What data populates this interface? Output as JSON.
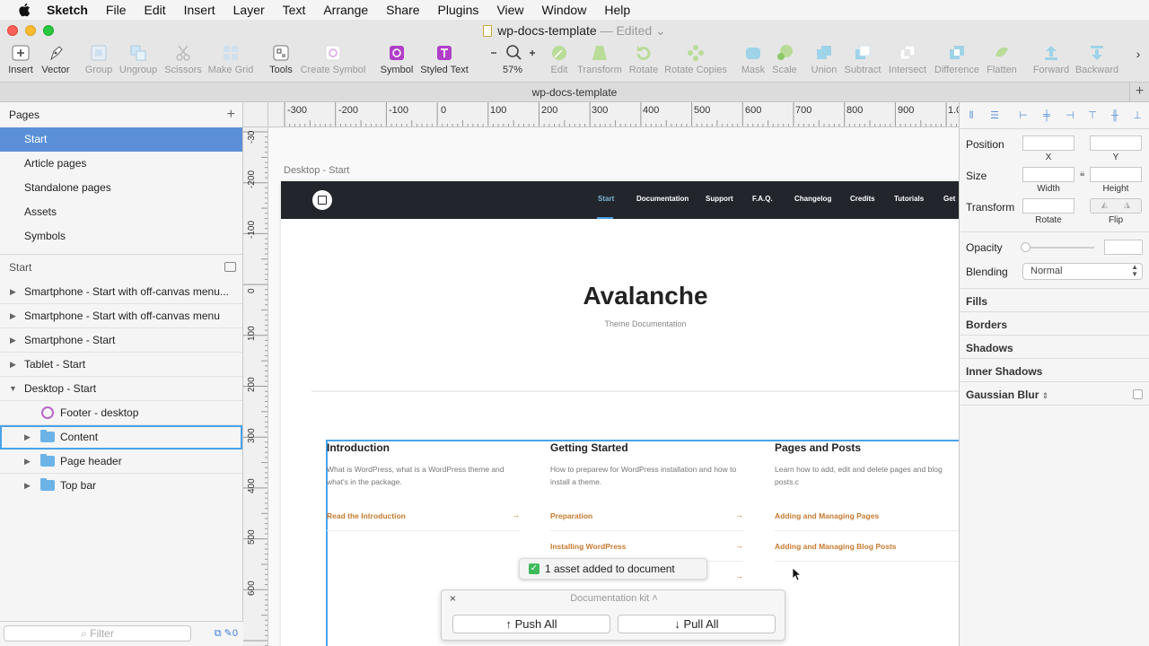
{
  "menubar": {
    "items": [
      "Sketch",
      "File",
      "Edit",
      "Insert",
      "Layer",
      "Text",
      "Arrange",
      "Share",
      "Plugins",
      "View",
      "Window",
      "Help"
    ]
  },
  "window": {
    "title": "wp-docs-template",
    "status": "— Edited"
  },
  "toolbar": {
    "insert": "Insert",
    "vector": "Vector",
    "group": "Group",
    "ungroup": "Ungroup",
    "scissors": "Scissors",
    "make_grid": "Make Grid",
    "tools": "Tools",
    "create_symbol": "Create Symbol",
    "symbol": "Symbol",
    "styled_text": "Styled Text",
    "zoom": "57%",
    "edit": "Edit",
    "transform": "Transform",
    "rotate": "Rotate",
    "rotate_copies": "Rotate Copies",
    "mask": "Mask",
    "scale": "Scale",
    "union": "Union",
    "subtract": "Subtract",
    "intersect": "Intersect",
    "difference": "Difference",
    "flatten": "Flatten",
    "forward": "Forward",
    "backward": "Backward",
    "colors": {
      "accent_purple": "#b040c8",
      "accent_green": "#7bc043",
      "accent_blue": "#5aa8d8"
    }
  },
  "tabbar": {
    "doc": "wp-docs-template"
  },
  "pages": {
    "header": "Pages",
    "items": [
      "Start",
      "Article pages",
      "Standalone pages",
      "Assets",
      "Symbols"
    ],
    "selected": "Start"
  },
  "layers": {
    "header": "Start",
    "items": [
      "Smartphone - Start with off-canvas menu...",
      "Smartphone - Start with off-canvas menu",
      "Smartphone - Start",
      "Tablet - Start",
      "Desktop - Start",
      "Footer - desktop",
      "Content",
      "Page header",
      "Top bar"
    ],
    "filter_placeholder": "Filter",
    "count": "0"
  },
  "ruler": {
    "top": [
      "-300",
      "-200",
      "-100",
      "0",
      "100",
      "200",
      "300",
      "400",
      "500",
      "600",
      "700",
      "800",
      "900",
      "1.0"
    ],
    "left": [
      "-30",
      "-200",
      "-100",
      "0",
      "100",
      "200",
      "300",
      "400",
      "500",
      "600"
    ]
  },
  "artboard": {
    "label": "Desktop - Start",
    "nav": [
      "Start",
      "Documentation",
      "Support",
      "F.A.Q.",
      "Changelog",
      "Credits",
      "Tutorials",
      "Get"
    ],
    "hero_title": "Avalanche",
    "hero_sub": "Theme Documentation",
    "columns": [
      {
        "title": "Introduction",
        "desc": "What is WordPress, what is a WordPress theme and what's in the package.",
        "links": [
          "Read the Introduction"
        ]
      },
      {
        "title": "Getting Started",
        "desc": "How to preparew for WordPress installation and how to install a theme.",
        "links": [
          "Preparation",
          "Installing WordPress"
        ]
      },
      {
        "title": "Pages and Posts",
        "desc": "Learn how to add, edit and delete pages and blog posts.c",
        "links": [
          "Adding and Managing Pages",
          "Adding and Managing Blog Posts"
        ]
      }
    ],
    "arrow": "→"
  },
  "toast": {
    "text": "1 asset added to document"
  },
  "kit": {
    "close": "×",
    "title": "Documentation kit ˄",
    "push": "↑ Push All",
    "pull": "↓ Pull All"
  },
  "inspector": {
    "position": "Position",
    "x": "X",
    "y": "Y",
    "size": "Size",
    "width": "Width",
    "height": "Height",
    "transform": "Transform",
    "rotate": "Rotate",
    "flip": "Flip",
    "opacity": "Opacity",
    "blending": "Blending",
    "blending_value": "Normal",
    "sections": [
      "Fills",
      "Borders",
      "Shadows",
      "Inner Shadows",
      "Gaussian Blur"
    ]
  }
}
